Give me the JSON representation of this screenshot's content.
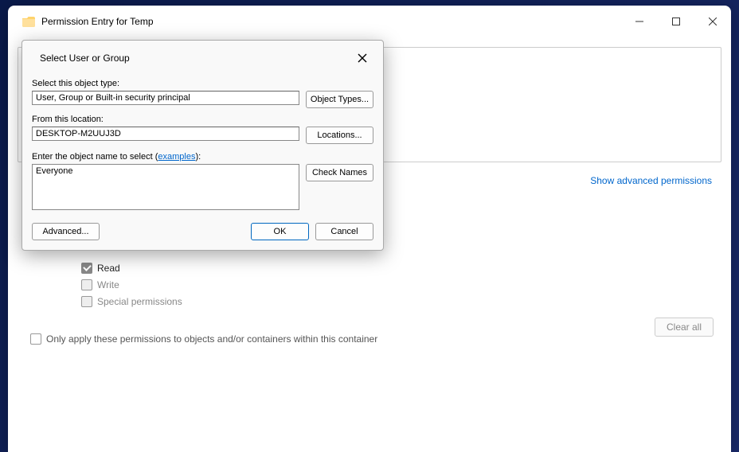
{
  "main": {
    "title": "Permission Entry for Temp",
    "advanced_link": "Show advanced permissions",
    "permissions": {
      "read": "Read",
      "write": "Write",
      "special": "Special permissions"
    },
    "only_apply": "Only apply these permissions to objects and/or containers within this container",
    "clear_all": "Clear all"
  },
  "modal": {
    "title": "Select User or Group",
    "object_type_label": "Select this object type:",
    "object_type_value": "User, Group or Built-in security principal",
    "object_types_btn": "Object Types...",
    "location_label": "From this location:",
    "location_value": "DESKTOP-M2UUJ3D",
    "locations_btn": "Locations...",
    "enter_prefix": "Enter the object name to select (",
    "examples": "examples",
    "enter_suffix": "):",
    "object_name_value": "Everyone",
    "check_names_btn": "Check Names",
    "advanced_btn": "Advanced...",
    "ok_btn": "OK",
    "cancel_btn": "Cancel"
  }
}
